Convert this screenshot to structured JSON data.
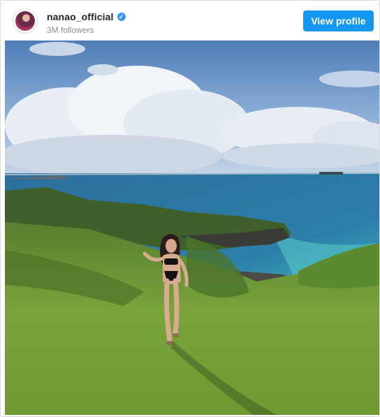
{
  "profile": {
    "username": "nanao_official",
    "followers": "3M followers",
    "verified_icon": "check",
    "view_profile_label": "View profile"
  },
  "colors": {
    "button": "#1497f2",
    "verified": "#3897f0",
    "sky": "#5f8fc7",
    "sea": "#2f7fa8",
    "grass": "#6f9b34"
  },
  "photo": {
    "icon": "photo-post"
  }
}
